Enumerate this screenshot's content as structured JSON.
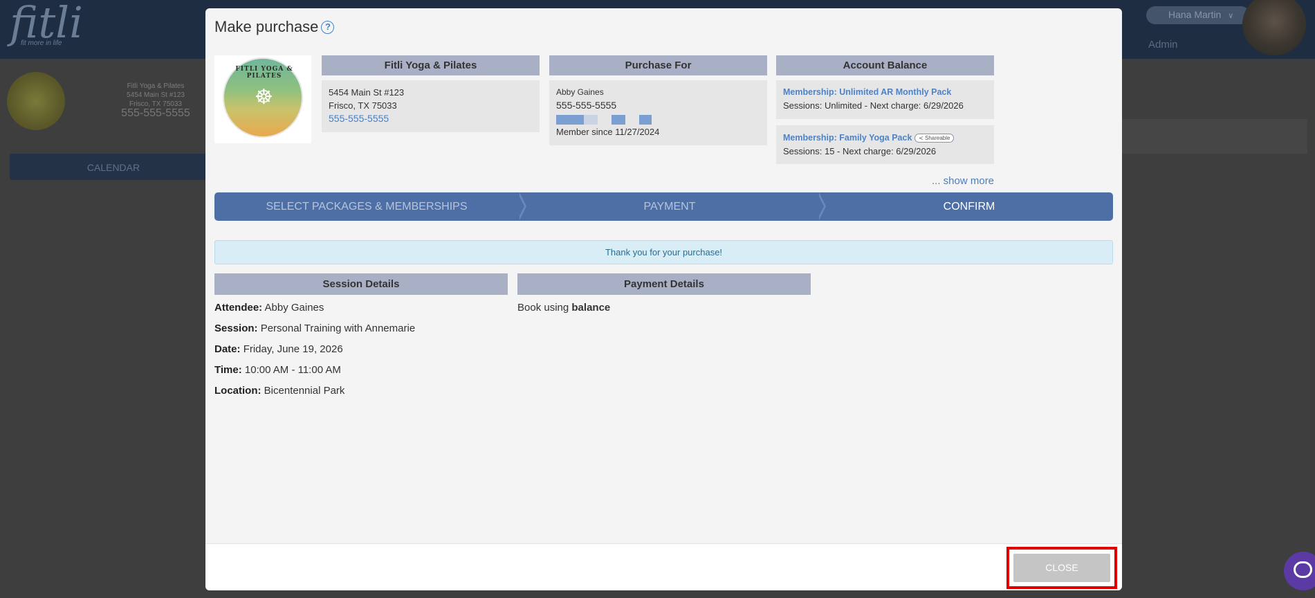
{
  "background_app": {
    "logo": "fitli",
    "tagline": "fit more in life",
    "user_name": "Hana Martin",
    "admin_label": "Admin",
    "studio_address_lines": [
      "Fitli Yoga & Pilates",
      "5454 Main St #123",
      "Frisco, TX 75033"
    ],
    "studio_phone": "555-555-5555",
    "calendar_label": "CALENDAR"
  },
  "modal": {
    "title": "Make purchase",
    "help_icon": "question-circle-icon",
    "studio": {
      "logo_text": "FITLI YOGA & PILATES",
      "header": "Fitli Yoga & Pilates",
      "address_line1": "5454 Main St #123",
      "address_line2": "Frisco, TX 75033",
      "phone": "555-555-5555"
    },
    "purchase_for": {
      "header": "Purchase For",
      "name": "Abby Gaines",
      "phone": "555-555-5555",
      "member_since": "Member since 11/27/2024"
    },
    "account_balance": {
      "header": "Account Balance",
      "items": [
        {
          "name": "Membership: Unlimited AR Monthly Pack",
          "details": "Sessions: Unlimited -  Next charge: 6/29/2026",
          "badge": ""
        },
        {
          "name": "Membership: Family Yoga Pack",
          "details": "Sessions: 15 -  Next charge: 6/29/2026",
          "badge": "Shareable"
        }
      ],
      "show_more": "... show more"
    },
    "steps": [
      {
        "label": "SELECT PACKAGES & MEMBERSHIPS",
        "active": false
      },
      {
        "label": "PAYMENT",
        "active": false
      },
      {
        "label": "CONFIRM",
        "active": true
      }
    ],
    "alert": "Thank you for your purchase!",
    "session_details": {
      "header": "Session Details",
      "attendee_label": "Attendee:",
      "attendee": "Abby Gaines",
      "session_label": "Session:",
      "session": "Personal Training with Annemarie",
      "date_label": "Date:",
      "date": "Friday, June 19, 2026",
      "time_label": "Time:",
      "time": "10:00 AM - 11:00 AM",
      "location_label": "Location:",
      "location": "Bicentennial Park"
    },
    "payment_details": {
      "header": "Payment Details",
      "prefix": "Book using",
      "method": "balance"
    },
    "close_label": "CLOSE"
  },
  "colors": {
    "accent": "#4d6fa6",
    "panel_header": "#a9b0c5",
    "link": "#4a7ec0",
    "highlight": "#e00000"
  }
}
